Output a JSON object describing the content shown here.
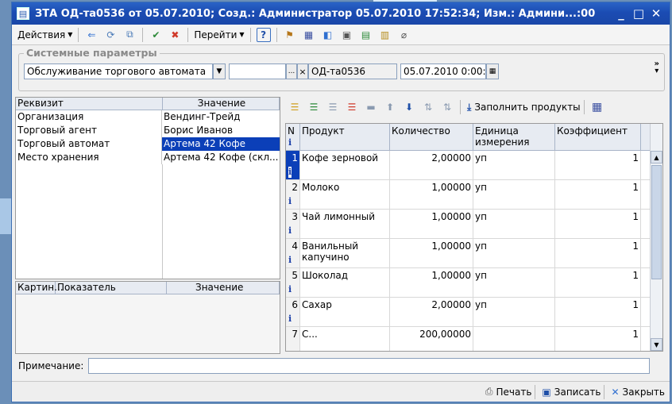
{
  "window": {
    "title": "ЗТА ОД-та0536 от 05.07.2010; Созд.: Администратор 05.07.2010 17:52:34; Изм.: Админи...:00"
  },
  "toolbar": {
    "actions_label": "Действия",
    "goto_label": "Перейти",
    "help_label": "?"
  },
  "system_params": {
    "title": "Системные параметры",
    "operation_type": "Обслуживание торгового автомата",
    "field2": "",
    "ellipsis": "...",
    "clear": "×",
    "doc_number": "ОД-та0536",
    "doc_date": "05.07.2010 0:00:",
    "more": "»"
  },
  "requisites": {
    "headers": [
      "Реквизит",
      "Значение"
    ],
    "rows": [
      {
        "name": "Организация",
        "value": "Вендинг-Трейд"
      },
      {
        "name": "Торговый агент",
        "value": "Борис Иванов"
      },
      {
        "name": "Торговый автомат",
        "value": "Артема 42 Кофе"
      },
      {
        "name": "Место хранения",
        "value": "Артема 42 Кофе (скл..."
      }
    ],
    "selected_index": 2
  },
  "indicators": {
    "headers": [
      "Картин...",
      "Показатель",
      "Значение"
    ]
  },
  "right_toolbar": {
    "fill_products_label": "Заполнить продукты"
  },
  "products": {
    "headers": {
      "n": "N",
      "product": "Продукт",
      "quantity": "Количество",
      "unit": "Единица измерения",
      "coef": "Коэффициент"
    },
    "rows": [
      {
        "n": "1",
        "product": "Кофе зерновой",
        "quantity": "2,00000",
        "unit": "уп",
        "coef": "1"
      },
      {
        "n": "2",
        "product": "Молоко",
        "quantity": "1,00000",
        "unit": "уп",
        "coef": "1"
      },
      {
        "n": "3",
        "product": "Чай лимонный",
        "quantity": "1,00000",
        "unit": "уп",
        "coef": "1"
      },
      {
        "n": "4",
        "product": "Ванильный капучино",
        "quantity": "1,00000",
        "unit": "уп",
        "coef": "1"
      },
      {
        "n": "5",
        "product": "Шоколад",
        "quantity": "1,00000",
        "unit": "уп",
        "coef": "1"
      },
      {
        "n": "6",
        "product": "Сахар",
        "quantity": "2,00000",
        "unit": "уп",
        "coef": "1"
      },
      {
        "n": "7",
        "product": "С...",
        "quantity": "200,00000",
        "unit": "",
        "coef": "1"
      }
    ],
    "current_index": 0,
    "info_glyph": "i"
  },
  "note": {
    "label": "Примечание:",
    "value": ""
  },
  "footer": {
    "print_label": "Печать",
    "save_label": "Записать",
    "close_label": "Закрыть"
  },
  "colors": {
    "title_bar": "#1b4cb3",
    "selection": "#0b3fb8",
    "accent_info": "#1a3ea8"
  }
}
